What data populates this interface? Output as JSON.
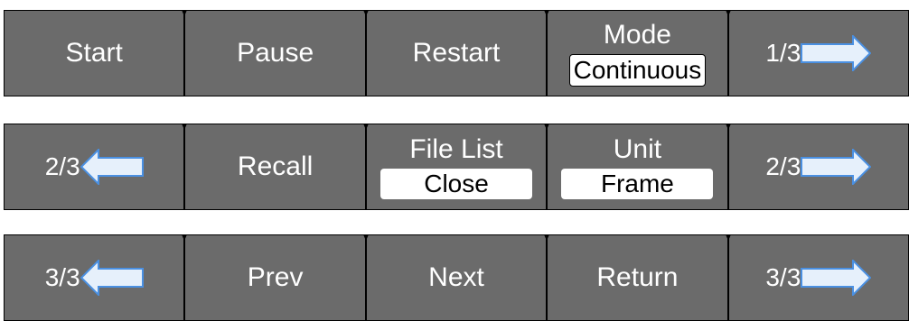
{
  "menu1": {
    "start": "Start",
    "pause": "Pause",
    "restart": "Restart",
    "mode_label": "Mode",
    "mode_value": "Continuous",
    "next_page": "1/3"
  },
  "menu2": {
    "prev_page": "2/3",
    "recall": "Recall",
    "file_list_label": "File List",
    "file_list_value": "Close",
    "unit_label": "Unit",
    "unit_value": "Frame",
    "next_page": "2/3"
  },
  "menu3": {
    "prev_page": "3/3",
    "prev": "Prev",
    "next": "Next",
    "return": "Return",
    "next_page": "3/3"
  },
  "colors": {
    "button_bg": "#6b6b6b",
    "text": "#ffffff",
    "value_box_bg": "#ffffff",
    "arrow_fill": "#e6f0fb",
    "arrow_stroke": "#4a90e2"
  },
  "icons": {
    "right_arrow": "arrow-right-icon",
    "left_arrow": "arrow-left-icon"
  }
}
